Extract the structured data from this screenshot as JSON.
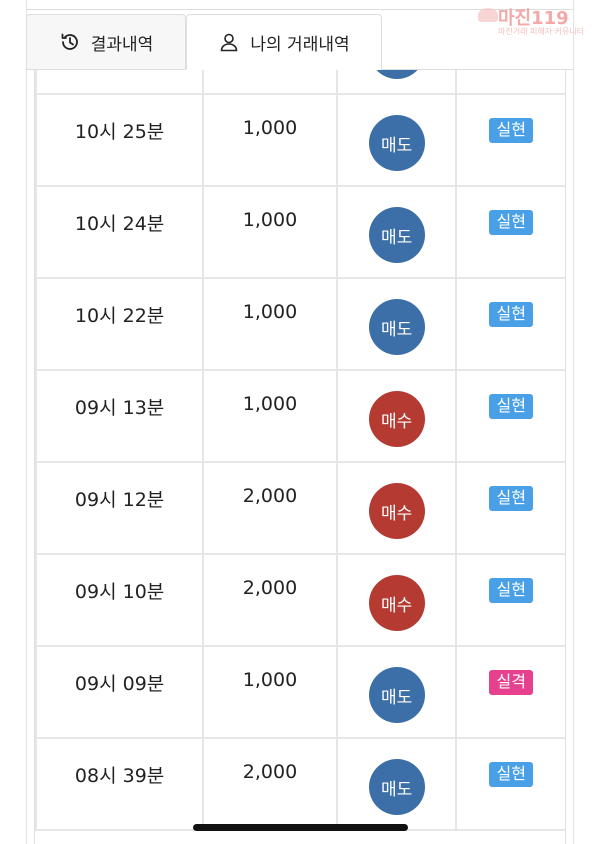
{
  "tabs": [
    {
      "label": "결과내역",
      "icon": "history-icon",
      "active": false
    },
    {
      "label": "나의 거래내역",
      "icon": "user-icon",
      "active": true
    }
  ],
  "watermark": {
    "logo": "마진119",
    "sub": "마진거래 피해자 커뮤니티"
  },
  "rows": [
    {
      "time": "10시 25분",
      "amount": "1,000",
      "type": "매도",
      "kind": "sell",
      "result": "실현",
      "status": "ok"
    },
    {
      "time": "10시 24분",
      "amount": "1,000",
      "type": "매도",
      "kind": "sell",
      "result": "실현",
      "status": "ok"
    },
    {
      "time": "10시 22분",
      "amount": "1,000",
      "type": "매도",
      "kind": "sell",
      "result": "실현",
      "status": "ok"
    },
    {
      "time": "09시 13분",
      "amount": "1,000",
      "type": "매수",
      "kind": "buy",
      "result": "실현",
      "status": "ok"
    },
    {
      "time": "09시 12분",
      "amount": "2,000",
      "type": "매수",
      "kind": "buy",
      "result": "실현",
      "status": "ok"
    },
    {
      "time": "09시 10분",
      "amount": "2,000",
      "type": "매수",
      "kind": "buy",
      "result": "실현",
      "status": "ok"
    },
    {
      "time": "09시 09분",
      "amount": "1,000",
      "type": "매도",
      "kind": "sell",
      "result": "실격",
      "status": "fail"
    },
    {
      "time": "08시 39분",
      "amount": "2,000",
      "type": "매도",
      "kind": "sell",
      "result": "실현",
      "status": "ok"
    }
  ],
  "colors": {
    "sell": "#3c6fa8",
    "buy": "#b43a32",
    "ok": "#4aa0e6",
    "fail": "#e6418f"
  }
}
